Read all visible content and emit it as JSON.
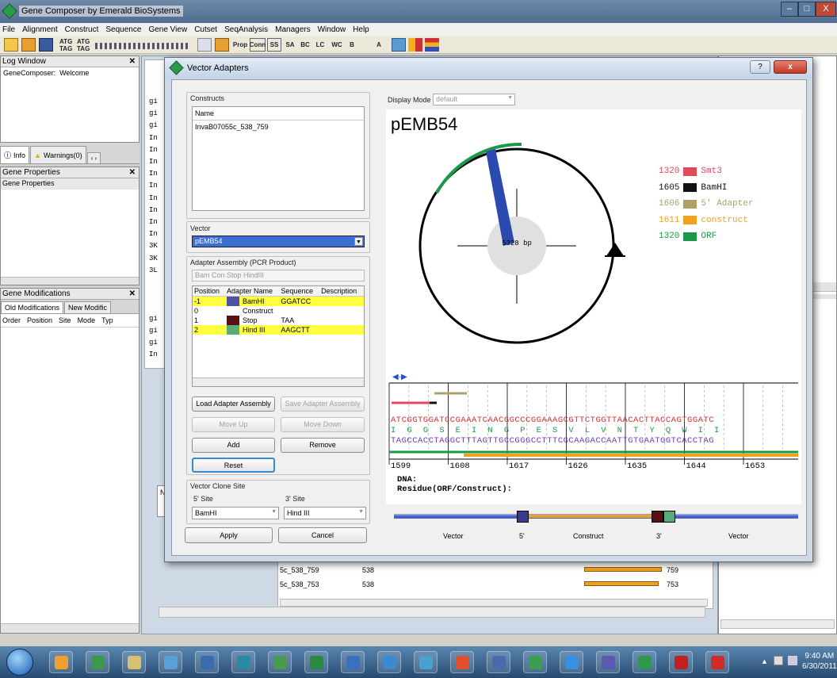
{
  "app": {
    "title": "Gene Composer by Emerald BioSystems",
    "window_buttons": [
      "–",
      "□",
      "X"
    ]
  },
  "menu": [
    "File",
    "Alignment",
    "Construct",
    "Sequence",
    "Gene View",
    "Cutset",
    "SeqAnalysis",
    "Managers",
    "Window",
    "Help"
  ],
  "toolbar": {
    "labels": [
      "ATG TAG",
      "ATG TAG",
      "Prop",
      "Conn",
      "SS",
      "SA",
      "BC",
      "LC",
      "WC",
      "B",
      "A"
    ]
  },
  "left": {
    "log_window": {
      "title": "Log Window",
      "line1_label": "GeneComposer:",
      "line1_text": "Welcome"
    },
    "info_tabs": {
      "info": "Info",
      "warnings": "Warnings(0)"
    },
    "gene_properties": {
      "title": "Gene Properties",
      "content": "Gene Properties"
    },
    "gene_modifications": {
      "title": "Gene Modifications",
      "tabs": [
        "Old Modifications",
        "New Modific"
      ],
      "columns": [
        "Order",
        "Position",
        "Site",
        "Mode",
        "Typ"
      ]
    }
  },
  "background": {
    "code_lines": [
      "gi",
      "gi",
      "gi",
      "In",
      "In",
      "In",
      "In",
      "In",
      "In",
      "In",
      "In",
      "In",
      "3K",
      "3K",
      "3L",
      "",
      "",
      "",
      "gi",
      "gi",
      "gi",
      "In"
    ],
    "tab_n": "N",
    "table_rows": [
      {
        "name": "5c_538_759",
        "len": "538",
        "end": "759"
      },
      {
        "name": "5c_538_753",
        "len": "538",
        "end": "753"
      }
    ]
  },
  "dialog": {
    "title": "Vector Adapters",
    "help": "?",
    "close": "x",
    "constructs": {
      "label": "Constructs",
      "column": "Name",
      "items": [
        "InvaB07055c_538_759"
      ]
    },
    "vector": {
      "label": "Vector",
      "selected": "pEMB54"
    },
    "assembly": {
      "label": "Adapter Assembly (PCR Product)",
      "summary": "Bam Con Stop HindIII",
      "columns": [
        "Position",
        "Adapter Name",
        "Sequence",
        "Description"
      ],
      "rows": [
        {
          "position": "-1",
          "name": "BamHI",
          "sequence": "GGATCC",
          "swatch": "#5050a8",
          "highlight": true
        },
        {
          "position": "0",
          "name": "Construct",
          "sequence": "",
          "swatch": "",
          "highlight": false
        },
        {
          "position": "1",
          "name": "Stop",
          "sequence": "TAA",
          "swatch": "#5a1010",
          "highlight": false
        },
        {
          "position": "2",
          "name": "Hind III",
          "sequence": "AAGCTT",
          "swatch": "#5aab78",
          "highlight": true
        }
      ]
    },
    "buttons": {
      "load": "Load Adapter Assembly",
      "save": "Save Adapter Assembly",
      "move_up": "Move Up",
      "move_down": "Move Down",
      "add": "Add",
      "remove": "Remove",
      "reset": "Reset",
      "apply": "Apply",
      "cancel": "Cancel"
    },
    "clone_site": {
      "label": "Vector Clone Site",
      "five_label": "5' Site",
      "three_label": "3' Site",
      "five_value": "BamHI",
      "three_value": "Hind III"
    },
    "display_mode": {
      "label": "Display Mode",
      "value": "default"
    },
    "map": {
      "name": "pEMB54",
      "size": "5328 bp",
      "legend": [
        {
          "pos": "1320",
          "name": "Smt3",
          "color": "#e04a5a",
          "text_color": "#e04a5a"
        },
        {
          "pos": "1605",
          "name": "BamHI",
          "color": "#111111",
          "text_color": "#111111"
        },
        {
          "pos": "1606",
          "name": "5' Adapter",
          "color": "#b0a068",
          "text_color": "#b0a068"
        },
        {
          "pos": "1611",
          "name": "construct",
          "color": "#f2a020",
          "text_color": "#f2a020"
        },
        {
          "pos": "1320",
          "name": "ORF",
          "color": "#1a9a48",
          "text_color": "#1a9a48"
        }
      ]
    },
    "sequence": {
      "top": "ATCGGTGGATCCGAAATCAACGGCCCGGAAAGCGTTCTGGTTAACACTTACCAGTGGATC",
      "aa": "I  G  G  S  E  I  N  G  P  E  S  V  L  V  N  T  Y  Q  W  I  I",
      "bottom": "TAGCCACCTAGGCTTTAGTTGCCGGGCCTTTCGCAAGACCAATTGTGAATGGTCACCTAG",
      "ticks": [
        "1599",
        "1608",
        "1617",
        "1626",
        "1635",
        "1644",
        "1653"
      ],
      "dna_label": "DNA:",
      "residue_label": "Residue(ORF/Construct):"
    },
    "bar_labels": [
      "Vector",
      "5'",
      "Construct",
      "3'",
      "Vector"
    ]
  },
  "taskbar": {
    "time": "9:40 AM",
    "date": "6/30/2011",
    "icons": [
      "start",
      "media",
      "chrome",
      "files",
      "monitor",
      "pictures",
      "outlook",
      "publisher",
      "excel",
      "word",
      "ie",
      "app",
      "foxit",
      "manager",
      "molecule",
      "skype",
      "itunes",
      "genecomposer",
      "acrobat",
      "paint"
    ]
  }
}
